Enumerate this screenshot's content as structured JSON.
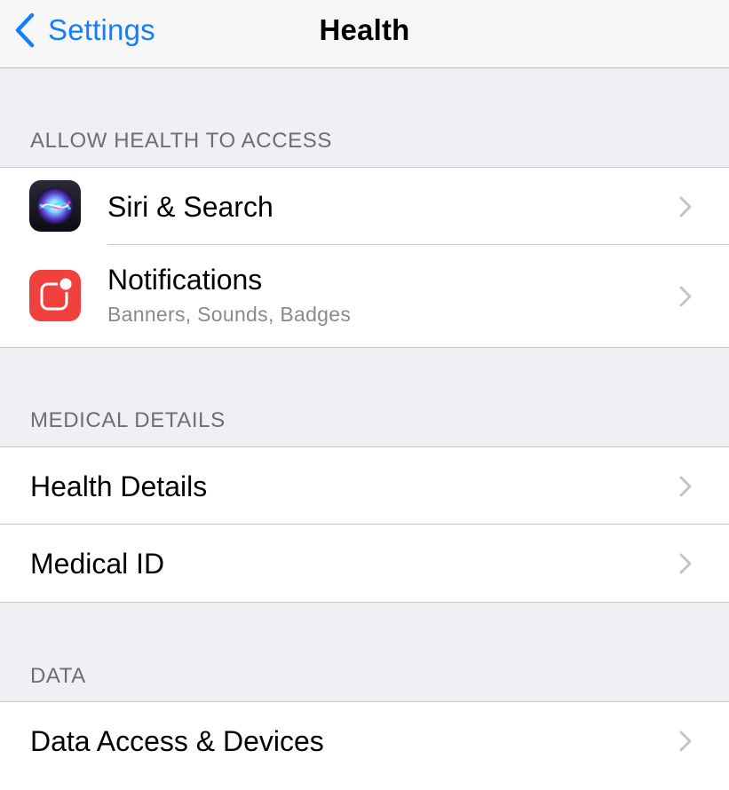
{
  "navbar": {
    "back_label": "Settings",
    "title": "Health"
  },
  "sections": {
    "allow_access": {
      "header": "ALLOW HEALTH TO ACCESS",
      "items": [
        {
          "title": "Siri & Search",
          "icon": "siri-icon"
        },
        {
          "title": "Notifications",
          "subtitle": "Banners, Sounds, Badges",
          "icon": "notifications-icon"
        }
      ]
    },
    "medical_details": {
      "header": "MEDICAL DETAILS",
      "items": [
        {
          "title": "Health Details"
        },
        {
          "title": "Medical ID"
        }
      ]
    },
    "data": {
      "header": "DATA",
      "items": [
        {
          "title": "Data Access & Devices"
        }
      ]
    }
  },
  "colors": {
    "accent": "#157efb",
    "background": "#efeff4",
    "notifications_icon": "#f0413c",
    "chevron": "#c4c4c7"
  }
}
